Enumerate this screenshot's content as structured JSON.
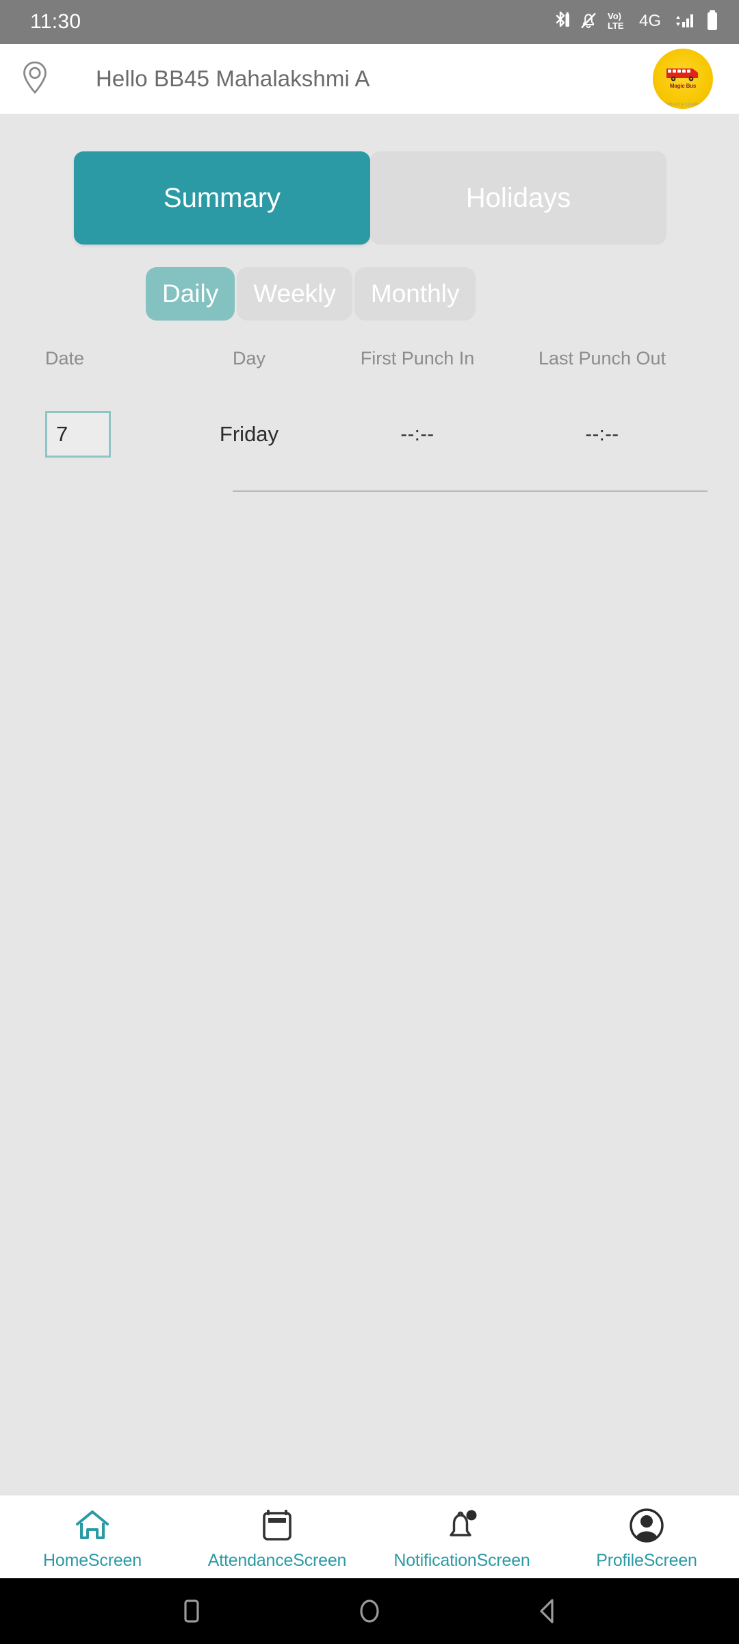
{
  "status_bar": {
    "time": "11:30",
    "icons": [
      "bluetooth-icon",
      "silent-icon",
      "volte-icon",
      "network-4g-icon",
      "signal-icon",
      "battery-icon"
    ],
    "network_label": "4G",
    "volte_label_top": "Vo)",
    "volte_label_bottom": "LTE",
    "background": "#7d7d7d"
  },
  "header": {
    "location_icon": "location-pin-icon",
    "greeting": "Hello BB45 Mahalakshmi A",
    "logo": {
      "name": "magic-bus-logo",
      "text": "Magic Bus",
      "tagline": "Childhood to Livelihood",
      "circle_color": "#f7c600",
      "bus_color": "#e2231a"
    }
  },
  "tabs": {
    "items": [
      {
        "label": "Summary",
        "active": true
      },
      {
        "label": "Holidays",
        "active": false
      }
    ],
    "active_color": "#2b9aa5",
    "inactive_color": "#dcdcdc"
  },
  "period_filter": {
    "items": [
      {
        "label": "Daily",
        "active": true
      },
      {
        "label": "Weekly",
        "active": false
      },
      {
        "label": "Monthly",
        "active": false
      }
    ],
    "active_color": "#84c2c1",
    "inactive_color": "#dcdcdc"
  },
  "table": {
    "columns": [
      "Date",
      "Day",
      "First Punch In",
      "Last Punch Out"
    ],
    "rows": [
      {
        "date": "7",
        "day": "Friday",
        "first_punch_in": "--:--",
        "last_punch_out": "--:--"
      }
    ],
    "date_chip_border": "#8fc5c5"
  },
  "bottom_nav": {
    "accent": "#2b9aa5",
    "items": [
      {
        "label": "HomeScreen",
        "icon": "home-icon",
        "active": true,
        "badge": false
      },
      {
        "label": "AttendanceScreen",
        "icon": "calendar-icon",
        "active": false,
        "badge": false
      },
      {
        "label": "NotificationScreen",
        "icon": "bell-icon",
        "active": false,
        "badge": true
      },
      {
        "label": "ProfileScreen",
        "icon": "person-icon",
        "active": false,
        "badge": false
      }
    ]
  },
  "system_nav": {
    "buttons": [
      "recents-square-icon",
      "home-circle-icon",
      "back-triangle-icon"
    ]
  }
}
